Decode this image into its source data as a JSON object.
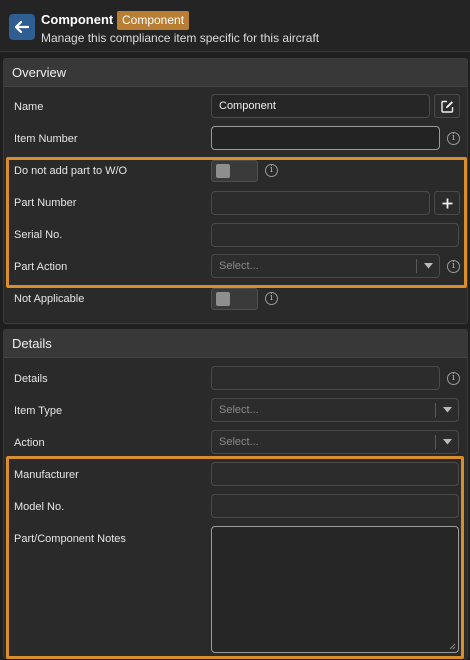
{
  "header": {
    "title": "Component",
    "badge": "Component",
    "subtitle": "Manage this compliance item specific for this aircraft"
  },
  "overview": {
    "heading": "Overview",
    "name_label": "Name",
    "name_value": "Component",
    "item_number_label": "Item Number",
    "item_number_value": "",
    "do_not_add_label": "Do not add part to W/O",
    "part_number_label": "Part Number",
    "serial_label": "Serial No.",
    "part_action_label": "Part Action",
    "part_action_placeholder": "Select...",
    "not_applicable_label": "Not Applicable"
  },
  "details": {
    "heading": "Details",
    "details_label": "Details",
    "item_type_label": "Item Type",
    "item_type_placeholder": "Select...",
    "action_label": "Action",
    "action_placeholder": "Select...",
    "manufacturer_label": "Manufacturer",
    "model_label": "Model No.",
    "notes_label": "Part/Component Notes"
  },
  "colors": {
    "accent_blue": "#2f5e93",
    "badge_orange": "#b87e33",
    "highlight_orange": "#d88d2f"
  }
}
